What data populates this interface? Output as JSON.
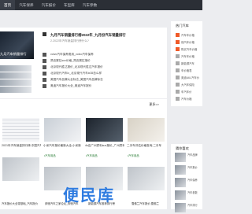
{
  "nav": {
    "items": [
      "首页",
      "汽车保养",
      "汽车报价",
      "车型库",
      "汽车参数"
    ]
  },
  "hero": {
    "caption": "九月汽车销量排行",
    "title": "九月汽车销量排行榜2022年_九月份汽车销量排行",
    "subtitle": "2.2022年汽车销量排行榜什么?"
  },
  "news": [
    "volvo汽车保养费用_volvo汽车保养",
    "昂克赛拉suv价格_昂克赛拉报价",
    "北京现代胜达报价_北京现代胜达汽车报价",
    "北京现代汽车ix_北京现代汽车ix35怎么样",
    "美国汽车品牌大全标志_美国汽车品牌标志",
    "奥迪汽车报价大全_奥迪汽车报价"
  ],
  "section2": {
    "more": "更多>>",
    "cards": [
      {
        "title": "2021年汽车销量排行榜,中国汽车",
        "tag": ""
      },
      {
        "title": "小米汽车报价最新大全,小米新",
        "tag": "•汽车用品"
      },
      {
        "title": "4s店广州宾利suv报价_广州宾利",
        "tag": "•汽车用品"
      },
      {
        "title": "二手车评估价格查询,二手车",
        "tag": "•汽车用品"
      }
    ],
    "bottom_titles": [
      "汽车报价大全零基础_汽车报价",
      "奔驰汽车之家论坛_奔驰汽车",
      "新能源汽车推荐排行榜",
      "雪佛兰汽车报价,雪佛兰"
    ],
    "watermark": "便民库"
  },
  "sidebar": {
    "title": "热门汽车",
    "items": [
      "汽车车价格",
      "保汽车价格",
      "购买汽车价格",
      "汽车车价格",
      "新能源汽车",
      "车价格表",
      "奥迪A6L汽车价",
      "大汽车保险",
      "车汽车价",
      "汽车价格"
    ],
    "hot_flags": [
      true,
      true,
      true,
      false,
      false,
      false,
      false,
      false,
      false,
      false
    ]
  },
  "sidebar2": {
    "title": "猜你喜欢",
    "items": [
      "汽车品牌",
      "汽车报价",
      "汽车保养",
      "汽车参数",
      "汽车排行"
    ]
  }
}
